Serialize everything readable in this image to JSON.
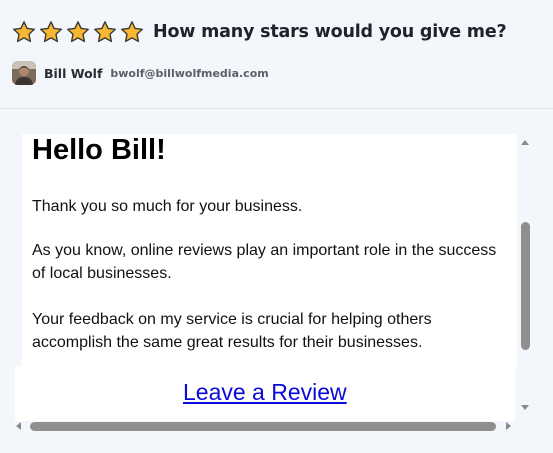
{
  "email": {
    "subject": "How many stars would you give me?",
    "rating_stars": 5,
    "sender": {
      "name": "Bill Wolf",
      "email": "bwolf@billwolfmedia.com"
    }
  },
  "body": {
    "greeting": "Hello Bill!",
    "paragraphs": [
      "Thank you so much for your business.",
      "As you know, online reviews play an important role in the success of local businesses.",
      "Your feedback on my service is crucial for helping others accomplish the same great results for their businesses."
    ],
    "cta_label": "Leave a Review"
  },
  "colors": {
    "star_fill": "#f7b733",
    "star_outline": "#3a3a3a",
    "link": "#0a0adb",
    "scroll_thumb": "#8f8f8f"
  },
  "icons": {
    "star": "star-icon",
    "avatar": "avatar",
    "scroll_up": "scroll-up-arrow-icon",
    "scroll_down": "scroll-down-arrow-icon",
    "scroll_left": "scroll-left-arrow-icon",
    "scroll_right": "scroll-right-arrow-icon"
  }
}
